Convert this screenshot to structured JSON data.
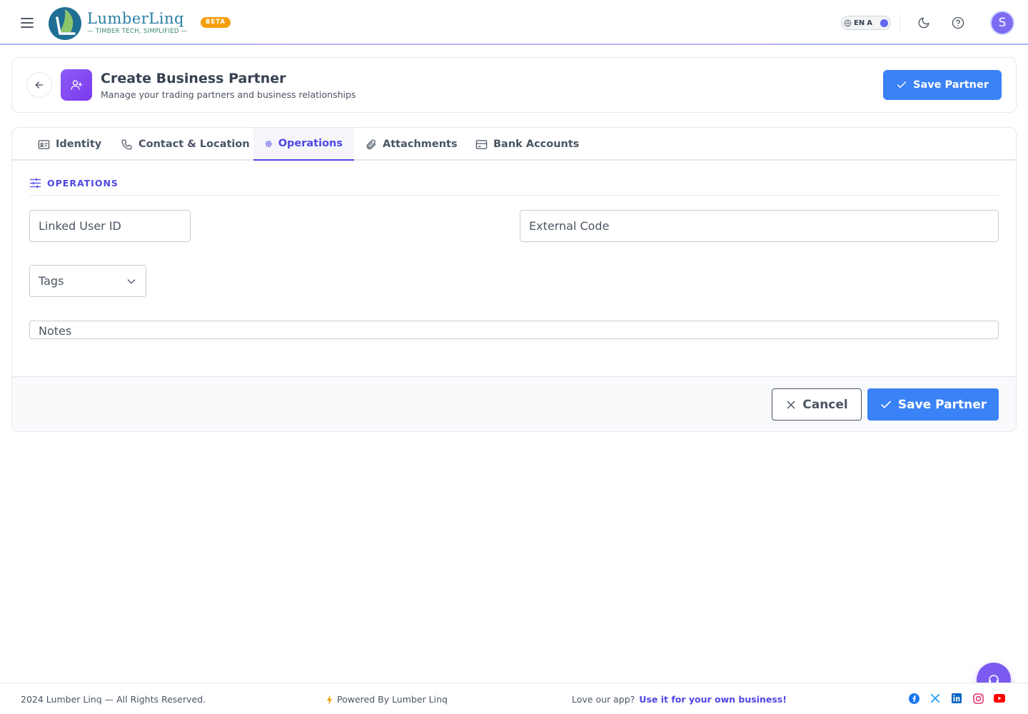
{
  "header": {
    "logo_name": "LumberLinq",
    "logo_tagline": "TIMBER TECH, SIMPLIFIED",
    "beta_badge": "BETA",
    "language": {
      "code": "EN",
      "alt": "A"
    },
    "avatar_initial": "S",
    "icons": [
      "menu-icon",
      "globe-icon",
      "moon-icon",
      "help-circle-icon"
    ]
  },
  "title_card": {
    "title": "Create Business Partner",
    "subtitle": "Manage your trading partners and business relationships",
    "save_label": "Save Partner"
  },
  "tabs": [
    {
      "label": "Identity",
      "icon": "id-card-icon",
      "active": false
    },
    {
      "label": "Contact & Location",
      "icon": "phone-icon",
      "active": false
    },
    {
      "label": "Operations",
      "icon": "gear-icon",
      "active": true
    },
    {
      "label": "Attachments",
      "icon": "paperclip-icon",
      "active": false
    },
    {
      "label": "Bank Accounts",
      "icon": "credit-card-icon",
      "active": false
    }
  ],
  "section": {
    "title": "OPERATIONS",
    "fields": {
      "linked_user_id": {
        "value": "",
        "placeholder": "Linked User ID"
      },
      "external_code": {
        "value": "",
        "placeholder": "External Code"
      },
      "tags": {
        "label": "Tags"
      },
      "notes": {
        "value": "",
        "placeholder": "Notes"
      }
    }
  },
  "form_footer": {
    "cancel_label": "Cancel",
    "save_label": "Save Partner"
  },
  "page_footer": {
    "copyright": "2024 Lumber Linq — All Rights Reserved.",
    "powered": "Powered By Lumber Linq",
    "love_text": "Love our app?",
    "love_link": "Use it for your own business!",
    "socials": [
      "facebook-icon",
      "x-icon",
      "linkedin-icon",
      "instagram-icon",
      "youtube-icon"
    ]
  },
  "colors": {
    "primary": "#3b82f6",
    "accent": "#4f46e5",
    "purple": "#7c5cf0",
    "beta": "#f59e0b"
  }
}
